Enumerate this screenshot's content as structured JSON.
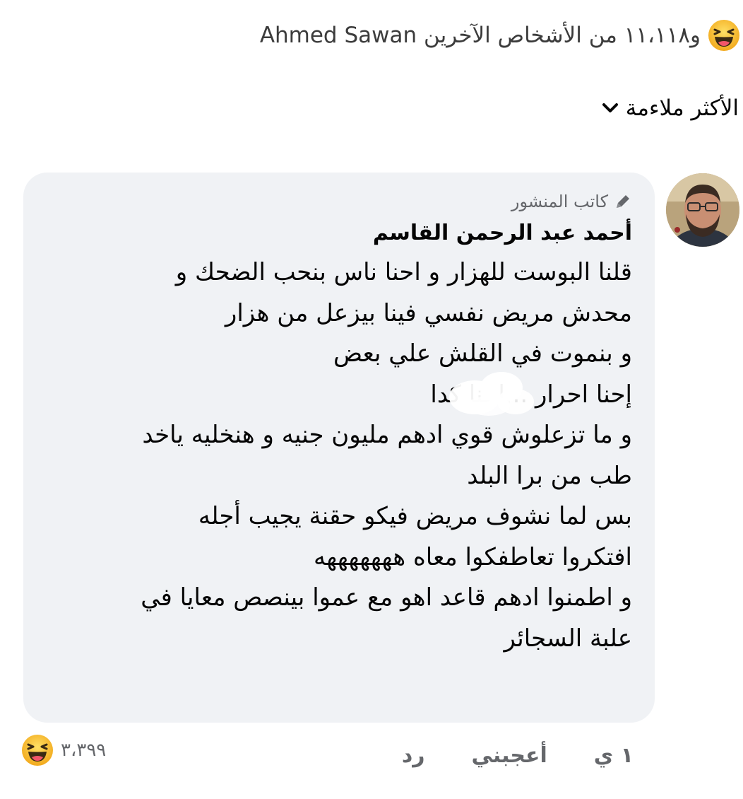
{
  "reactions_summary": {
    "icon": "haha-emoji-icon",
    "text": "و١١،١١٨ من الأشخاص الآخرين Ahmed Sawan"
  },
  "sort": {
    "label": "الأكثر ملاءمة",
    "icon": "chevron-down-icon"
  },
  "comment": {
    "author_badge": {
      "icon": "pencil-icon",
      "label": "كاتب المنشور"
    },
    "author_name": "أحمد عبد الرحمن القاسم",
    "text": "قلنا البوست للهزار و احنا ناس بنحب الضحك و\nمحدش مريض نفسي فينا بيزعل من هزار\nو بنموت في القلش علي بعض\nإحنا احرار ...احنا كدا\nو ما تزعلوش قوي ادهم مليون جنيه و هنخليه ياخد\nطب من برا البلد\nبس لما نشوف مريض فيكو حقنة يجيب أجله\nافتكروا تعاطفكوا معاه هههههههه\nو اطمنوا ادهم قاعد اهو مع عموا بينصص معايا في\nعلبة السجائر",
    "actions": {
      "time": "١ ي",
      "like": "أعجبني",
      "reply": "رد"
    },
    "reactions": {
      "icon": "haha-emoji-icon",
      "count": "٣،٣٩٩"
    }
  },
  "colors": {
    "bubble_bg": "#f0f2f5",
    "secondary_text": "#65676b",
    "emoji_yellow": "#f7b928"
  }
}
